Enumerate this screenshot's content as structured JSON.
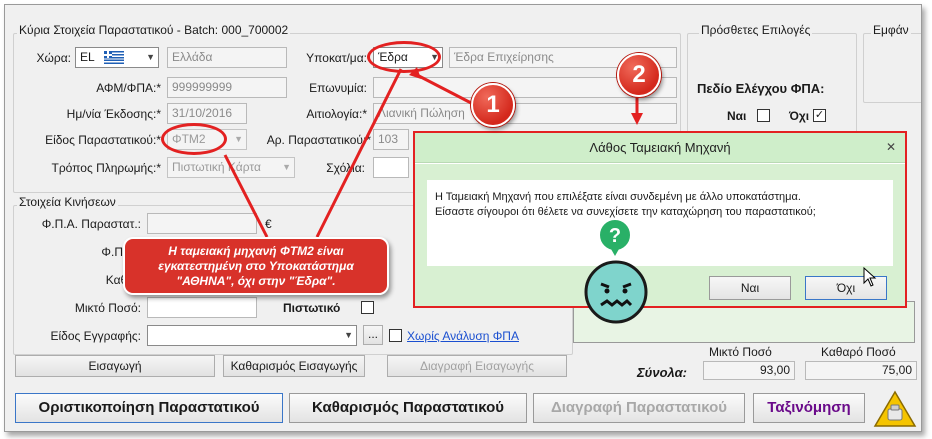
{
  "header": {
    "group_title": "Κύρια Στοιχεία Παραστατικού - Batch: 000_700002",
    "extra_options": "Πρόσθετες Επιλογές",
    "tab_partial": "Εμφάν"
  },
  "fields": {
    "country_label": "Χώρα:",
    "country_code": "EL",
    "country_name": "Ελλάδα",
    "branch_label": "Υποκατ/μα:",
    "branch_value": "Έδρα",
    "branch_desc": "Έδρα Επιχείρησης",
    "vat_label": "ΑΦΜ/ΦΠΑ:*",
    "vat_value": "999999999",
    "name_label": "Επωνυμία:",
    "date_label": "Ημ/νία Έκδοσης:*",
    "date_value": "31/10/2016",
    "reason_label": "Αιτιολογία:*",
    "reason_value": "Λιανική Πώληση",
    "doctype_label": "Είδος Παραστατικού:*",
    "doctype_value": "ΦΤΜ2",
    "docnum_label": "Αρ. Παραστατικού:*",
    "docnum_value": "103",
    "payment_label": "Τρόπος Πληρωμής:*",
    "payment_value": "Πιστωτική Κάρτα",
    "comments_label": "Σχόλια:"
  },
  "vat_check": {
    "title": "Πεδίο Ελέγχου ΦΠΑ:",
    "yes": "Ναι",
    "no": "Όχι"
  },
  "movements": {
    "title": "Στοιχεία Κινήσεων",
    "vat_doc_label": "Φ.Π.Α. Παραστατ.:",
    "currency": "€",
    "vat_label": "Φ.Π.Α.:",
    "net_label": "Καθαρ",
    "gross_label": "Μικτό Ποσό:",
    "credit_label": "Πιστωτικό",
    "entry_type_label": "Είδος Εγγραφής:",
    "ellipsis": "...",
    "no_vat_analysis": "Χωρίς Ανάλυση ΦΠΑ"
  },
  "buttons": {
    "insert": "Εισαγωγή",
    "clear_insert": "Καθαρισμός Εισαγωγής",
    "delete_insert": "Διαγραφή Εισαγωγής",
    "finalize": "Οριστικοποίηση Παραστατικού",
    "clear_doc": "Καθαρισμός Παραστατικού",
    "delete_doc": "Διαγραφή Παραστατικού",
    "sort": "Ταξινόμηση"
  },
  "totals": {
    "label": "Σύνολα:",
    "gross_header": "Μικτό Ποσό",
    "net_header": "Καθαρό Ποσό",
    "gross_value": "93,00",
    "net_value": "75,00"
  },
  "dialog": {
    "title": "Λάθος Ταμειακή Μηχανή",
    "close": "✕",
    "message_line1": "Η Ταμειακή Μηχανή που επιλέξατε είναι συνδεμένη με άλλο υποκατάστημα.",
    "message_line2": "Είσαστε σίγουροι ότι θέλετε να συνεχίσετε την καταχώρηση του παραστατικού;",
    "yes": "Ναι",
    "no": "Όχι"
  },
  "annotations": {
    "badge1": "1",
    "badge2": "2",
    "callout": "Η ταμειακή μηχανή  ΦΤΜ2 είναι εγκατεστημένη στο Υποκατάστημα \"ΑΘΗΝΑ\", όχι στην \"Έδρα\".",
    "question": "?"
  },
  "colors": {
    "highlight": "#e32121",
    "dialog_bg": "#d8f0d2",
    "sort_text": "#6a0a8a",
    "link": "#1a4fd0"
  }
}
